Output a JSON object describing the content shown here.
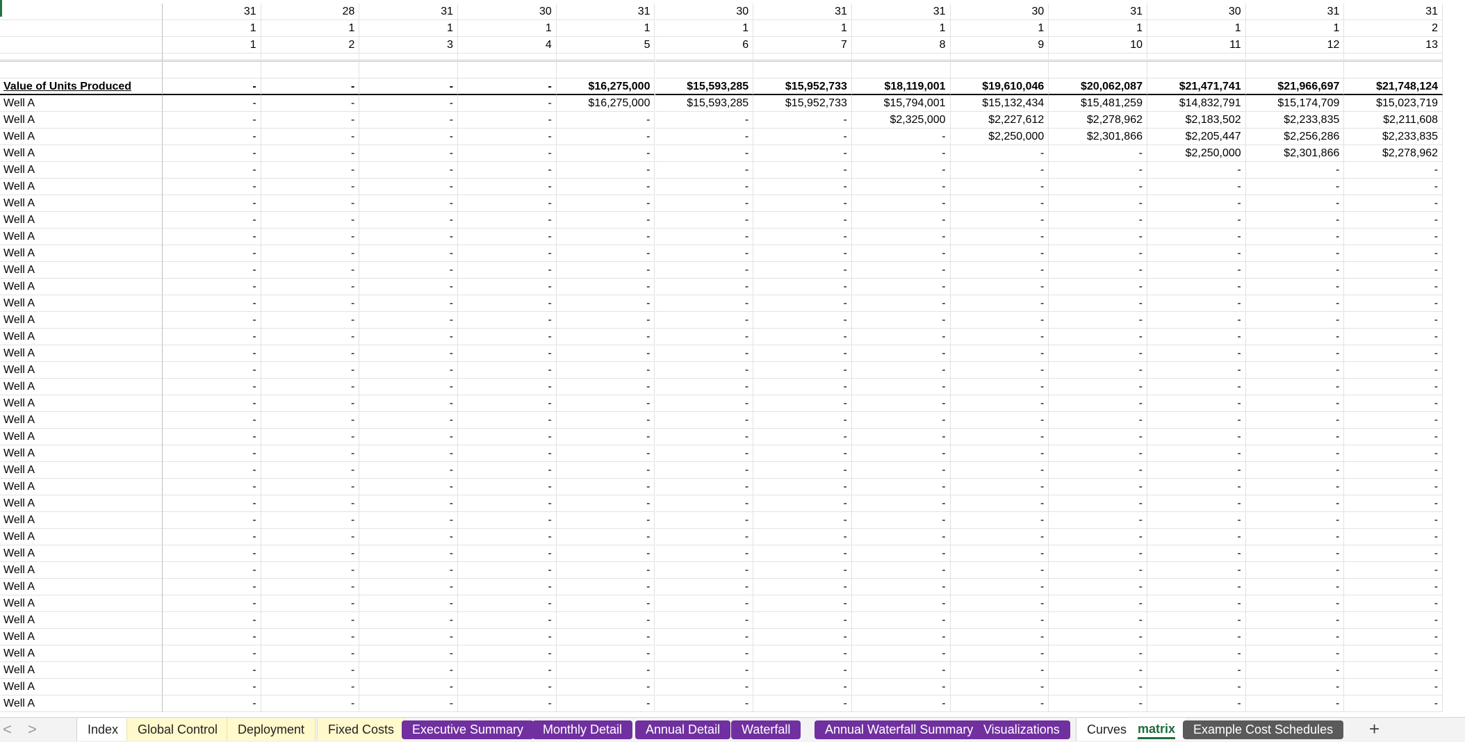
{
  "sheet": {
    "header_rows": [
      {
        "label": "",
        "values": [
          "31",
          "28",
          "31",
          "30",
          "31",
          "30",
          "31",
          "31",
          "30",
          "31",
          "30",
          "31",
          "31"
        ]
      },
      {
        "label": "",
        "values": [
          "1",
          "1",
          "1",
          "1",
          "1",
          "1",
          "1",
          "1",
          "1",
          "1",
          "1",
          "1",
          "2"
        ]
      },
      {
        "label": "",
        "values": [
          "1",
          "2",
          "3",
          "4",
          "5",
          "6",
          "7",
          "8",
          "9",
          "10",
          "11",
          "12",
          "13"
        ]
      }
    ],
    "title_row": {
      "label": "Value of Units Produced",
      "values": [
        "-",
        "-",
        "-",
        "-",
        "$16,275,000",
        "$15,593,285",
        "$15,952,733",
        "$18,119,001",
        "$19,610,046",
        "$20,062,087",
        "$21,471,741",
        "$21,966,697",
        "$21,748,124"
      ]
    },
    "data_rows": [
      {
        "label": "Well A",
        "values": [
          "-",
          "-",
          "-",
          "-",
          "$16,275,000",
          "$15,593,285",
          "$15,952,733",
          "$15,794,001",
          "$15,132,434",
          "$15,481,259",
          "$14,832,791",
          "$15,174,709",
          "$15,023,719"
        ]
      },
      {
        "label": "Well A",
        "values": [
          "-",
          "-",
          "-",
          "-",
          "-",
          "-",
          "-",
          "$2,325,000",
          "$2,227,612",
          "$2,278,962",
          "$2,183,502",
          "$2,233,835",
          "$2,211,608"
        ]
      },
      {
        "label": "Well A",
        "values": [
          "-",
          "-",
          "-",
          "-",
          "-",
          "-",
          "-",
          "-",
          "$2,250,000",
          "$2,301,866",
          "$2,205,447",
          "$2,256,286",
          "$2,233,835"
        ]
      },
      {
        "label": "Well A",
        "values": [
          "-",
          "-",
          "-",
          "-",
          "-",
          "-",
          "-",
          "-",
          "-",
          "-",
          "$2,250,000",
          "$2,301,866",
          "$2,278,962"
        ]
      },
      {
        "label": "Well A",
        "values": [
          "-",
          "-",
          "-",
          "-",
          "-",
          "-",
          "-",
          "-",
          "-",
          "-",
          "-",
          "-",
          "-"
        ]
      },
      {
        "label": "Well A",
        "values": [
          "-",
          "-",
          "-",
          "-",
          "-",
          "-",
          "-",
          "-",
          "-",
          "-",
          "-",
          "-",
          "-"
        ]
      },
      {
        "label": "Well A",
        "values": [
          "-",
          "-",
          "-",
          "-",
          "-",
          "-",
          "-",
          "-",
          "-",
          "-",
          "-",
          "-",
          "-"
        ]
      },
      {
        "label": "Well A",
        "values": [
          "-",
          "-",
          "-",
          "-",
          "-",
          "-",
          "-",
          "-",
          "-",
          "-",
          "-",
          "-",
          "-"
        ]
      },
      {
        "label": "Well A",
        "values": [
          "-",
          "-",
          "-",
          "-",
          "-",
          "-",
          "-",
          "-",
          "-",
          "-",
          "-",
          "-",
          "-"
        ]
      },
      {
        "label": "Well A",
        "values": [
          "-",
          "-",
          "-",
          "-",
          "-",
          "-",
          "-",
          "-",
          "-",
          "-",
          "-",
          "-",
          "-"
        ]
      },
      {
        "label": "Well A",
        "values": [
          "-",
          "-",
          "-",
          "-",
          "-",
          "-",
          "-",
          "-",
          "-",
          "-",
          "-",
          "-",
          "-"
        ]
      },
      {
        "label": "Well A",
        "values": [
          "-",
          "-",
          "-",
          "-",
          "-",
          "-",
          "-",
          "-",
          "-",
          "-",
          "-",
          "-",
          "-"
        ]
      },
      {
        "label": "Well A",
        "values": [
          "-",
          "-",
          "-",
          "-",
          "-",
          "-",
          "-",
          "-",
          "-",
          "-",
          "-",
          "-",
          "-"
        ]
      },
      {
        "label": "Well A",
        "values": [
          "-",
          "-",
          "-",
          "-",
          "-",
          "-",
          "-",
          "-",
          "-",
          "-",
          "-",
          "-",
          "-"
        ]
      },
      {
        "label": "Well A",
        "values": [
          "-",
          "-",
          "-",
          "-",
          "-",
          "-",
          "-",
          "-",
          "-",
          "-",
          "-",
          "-",
          "-"
        ]
      },
      {
        "label": "Well A",
        "values": [
          "-",
          "-",
          "-",
          "-",
          "-",
          "-",
          "-",
          "-",
          "-",
          "-",
          "-",
          "-",
          "-"
        ]
      },
      {
        "label": "Well A",
        "values": [
          "-",
          "-",
          "-",
          "-",
          "-",
          "-",
          "-",
          "-",
          "-",
          "-",
          "-",
          "-",
          "-"
        ]
      },
      {
        "label": "Well A",
        "values": [
          "-",
          "-",
          "-",
          "-",
          "-",
          "-",
          "-",
          "-",
          "-",
          "-",
          "-",
          "-",
          "-"
        ]
      },
      {
        "label": "Well A",
        "values": [
          "-",
          "-",
          "-",
          "-",
          "-",
          "-",
          "-",
          "-",
          "-",
          "-",
          "-",
          "-",
          "-"
        ]
      },
      {
        "label": "Well A",
        "values": [
          "-",
          "-",
          "-",
          "-",
          "-",
          "-",
          "-",
          "-",
          "-",
          "-",
          "-",
          "-",
          "-"
        ]
      },
      {
        "label": "Well A",
        "values": [
          "-",
          "-",
          "-",
          "-",
          "-",
          "-",
          "-",
          "-",
          "-",
          "-",
          "-",
          "-",
          "-"
        ]
      },
      {
        "label": "Well A",
        "values": [
          "-",
          "-",
          "-",
          "-",
          "-",
          "-",
          "-",
          "-",
          "-",
          "-",
          "-",
          "-",
          "-"
        ]
      },
      {
        "label": "Well A",
        "values": [
          "-",
          "-",
          "-",
          "-",
          "-",
          "-",
          "-",
          "-",
          "-",
          "-",
          "-",
          "-",
          "-"
        ]
      },
      {
        "label": "Well A",
        "values": [
          "-",
          "-",
          "-",
          "-",
          "-",
          "-",
          "-",
          "-",
          "-",
          "-",
          "-",
          "-",
          "-"
        ]
      },
      {
        "label": "Well A",
        "values": [
          "-",
          "-",
          "-",
          "-",
          "-",
          "-",
          "-",
          "-",
          "-",
          "-",
          "-",
          "-",
          "-"
        ]
      },
      {
        "label": "Well A",
        "values": [
          "-",
          "-",
          "-",
          "-",
          "-",
          "-",
          "-",
          "-",
          "-",
          "-",
          "-",
          "-",
          "-"
        ]
      },
      {
        "label": "Well A",
        "values": [
          "-",
          "-",
          "-",
          "-",
          "-",
          "-",
          "-",
          "-",
          "-",
          "-",
          "-",
          "-",
          "-"
        ]
      },
      {
        "label": "Well A",
        "values": [
          "-",
          "-",
          "-",
          "-",
          "-",
          "-",
          "-",
          "-",
          "-",
          "-",
          "-",
          "-",
          "-"
        ]
      },
      {
        "label": "Well A",
        "values": [
          "-",
          "-",
          "-",
          "-",
          "-",
          "-",
          "-",
          "-",
          "-",
          "-",
          "-",
          "-",
          "-"
        ]
      },
      {
        "label": "Well A",
        "values": [
          "-",
          "-",
          "-",
          "-",
          "-",
          "-",
          "-",
          "-",
          "-",
          "-",
          "-",
          "-",
          "-"
        ]
      },
      {
        "label": "Well A",
        "values": [
          "-",
          "-",
          "-",
          "-",
          "-",
          "-",
          "-",
          "-",
          "-",
          "-",
          "-",
          "-",
          "-"
        ]
      },
      {
        "label": "Well A",
        "values": [
          "-",
          "-",
          "-",
          "-",
          "-",
          "-",
          "-",
          "-",
          "-",
          "-",
          "-",
          "-",
          "-"
        ]
      },
      {
        "label": "Well A",
        "values": [
          "-",
          "-",
          "-",
          "-",
          "-",
          "-",
          "-",
          "-",
          "-",
          "-",
          "-",
          "-",
          "-"
        ]
      },
      {
        "label": "Well A",
        "values": [
          "-",
          "-",
          "-",
          "-",
          "-",
          "-",
          "-",
          "-",
          "-",
          "-",
          "-",
          "-",
          "-"
        ]
      },
      {
        "label": "Well A",
        "values": [
          "-",
          "-",
          "-",
          "-",
          "-",
          "-",
          "-",
          "-",
          "-",
          "-",
          "-",
          "-",
          "-"
        ]
      },
      {
        "label": "Well A",
        "values": [
          "-",
          "-",
          "-",
          "-",
          "-",
          "-",
          "-",
          "-",
          "-",
          "-",
          "-",
          "-",
          "-"
        ]
      },
      {
        "label": "Well A",
        "values": [
          "-",
          "-",
          "-",
          "-",
          "-",
          "-",
          "-",
          "-",
          "-",
          "-",
          "-",
          "-",
          "-"
        ]
      }
    ]
  },
  "tabs": {
    "add_label": "+",
    "prev_label": "<",
    "next_label": ">",
    "items": [
      {
        "label": "Index",
        "style": "light"
      },
      {
        "label": "Global Control",
        "style": "yellow"
      },
      {
        "label": "Deployment",
        "style": "yellow"
      },
      {
        "label": "Fixed Costs",
        "style": "yellow"
      },
      {
        "label": "Executive Summary",
        "style": "purple"
      },
      {
        "label": "Monthly Detail",
        "style": "purple"
      },
      {
        "label": "Annual Detail",
        "style": "purple"
      },
      {
        "label": "Waterfall",
        "style": "purple"
      },
      {
        "label": "Annual Waterfall Summary",
        "style": "purple"
      },
      {
        "label": "Visualizations",
        "style": "purple"
      },
      {
        "label": "Curves",
        "style": "light"
      },
      {
        "label": "matrix",
        "style": "active"
      },
      {
        "label": "Example Cost Schedules",
        "style": "gray"
      }
    ],
    "accent_active": "#1e6b3c",
    "accent_purple": "#7030a0"
  }
}
